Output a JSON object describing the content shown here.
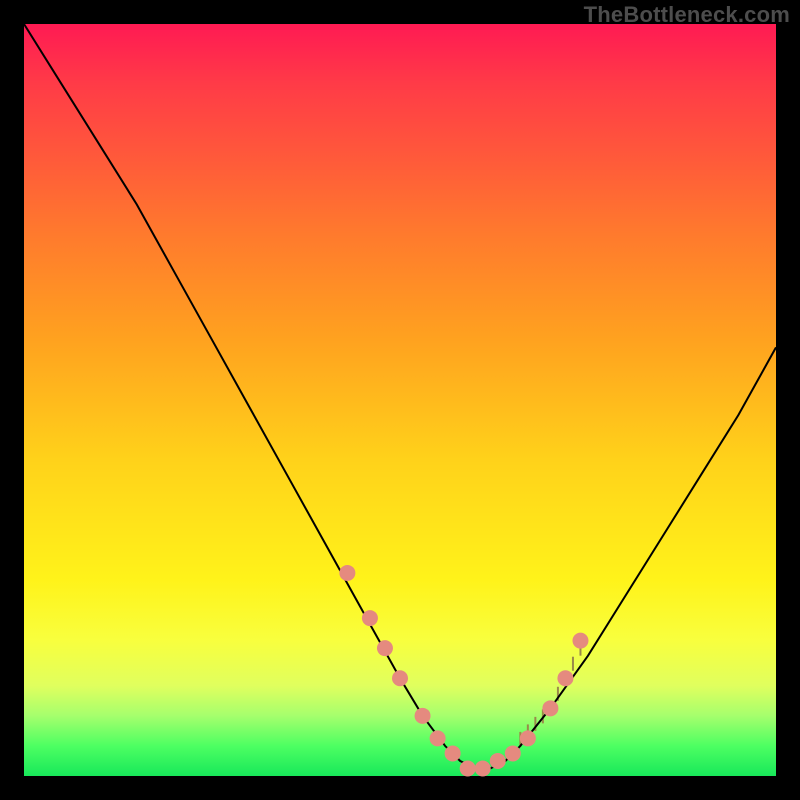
{
  "watermark": "TheBottleneck.com",
  "colors": {
    "background": "#000000",
    "curve": "#000000",
    "markers": "#e58a7f",
    "tick": "#9a8a4a"
  },
  "chart_data": {
    "type": "line",
    "title": "",
    "xlabel": "",
    "ylabel": "",
    "xlim": [
      0,
      100
    ],
    "ylim": [
      0,
      100
    ],
    "x": [
      0,
      5,
      10,
      15,
      20,
      25,
      30,
      35,
      40,
      45,
      50,
      53,
      56,
      58,
      60,
      62,
      64,
      66,
      70,
      75,
      80,
      85,
      90,
      95,
      100
    ],
    "y": [
      100,
      92,
      84,
      76,
      67,
      58,
      49,
      40,
      31,
      22,
      13,
      8,
      4,
      2,
      1,
      1,
      2,
      4,
      9,
      16,
      24,
      32,
      40,
      48,
      57
    ],
    "markers_x": [
      43,
      46,
      48,
      50,
      53,
      55,
      57,
      59,
      61,
      63,
      65,
      67,
      70,
      72,
      74
    ],
    "markers_y": [
      27,
      21,
      17,
      13,
      8,
      5,
      3,
      1,
      1,
      2,
      3,
      5,
      9,
      13,
      18
    ],
    "ticks_x": [
      66,
      67,
      68,
      69,
      70,
      71,
      72,
      73,
      74
    ],
    "ticks_y": [
      4,
      5,
      6,
      7,
      8,
      10,
      12,
      14,
      16
    ]
  }
}
